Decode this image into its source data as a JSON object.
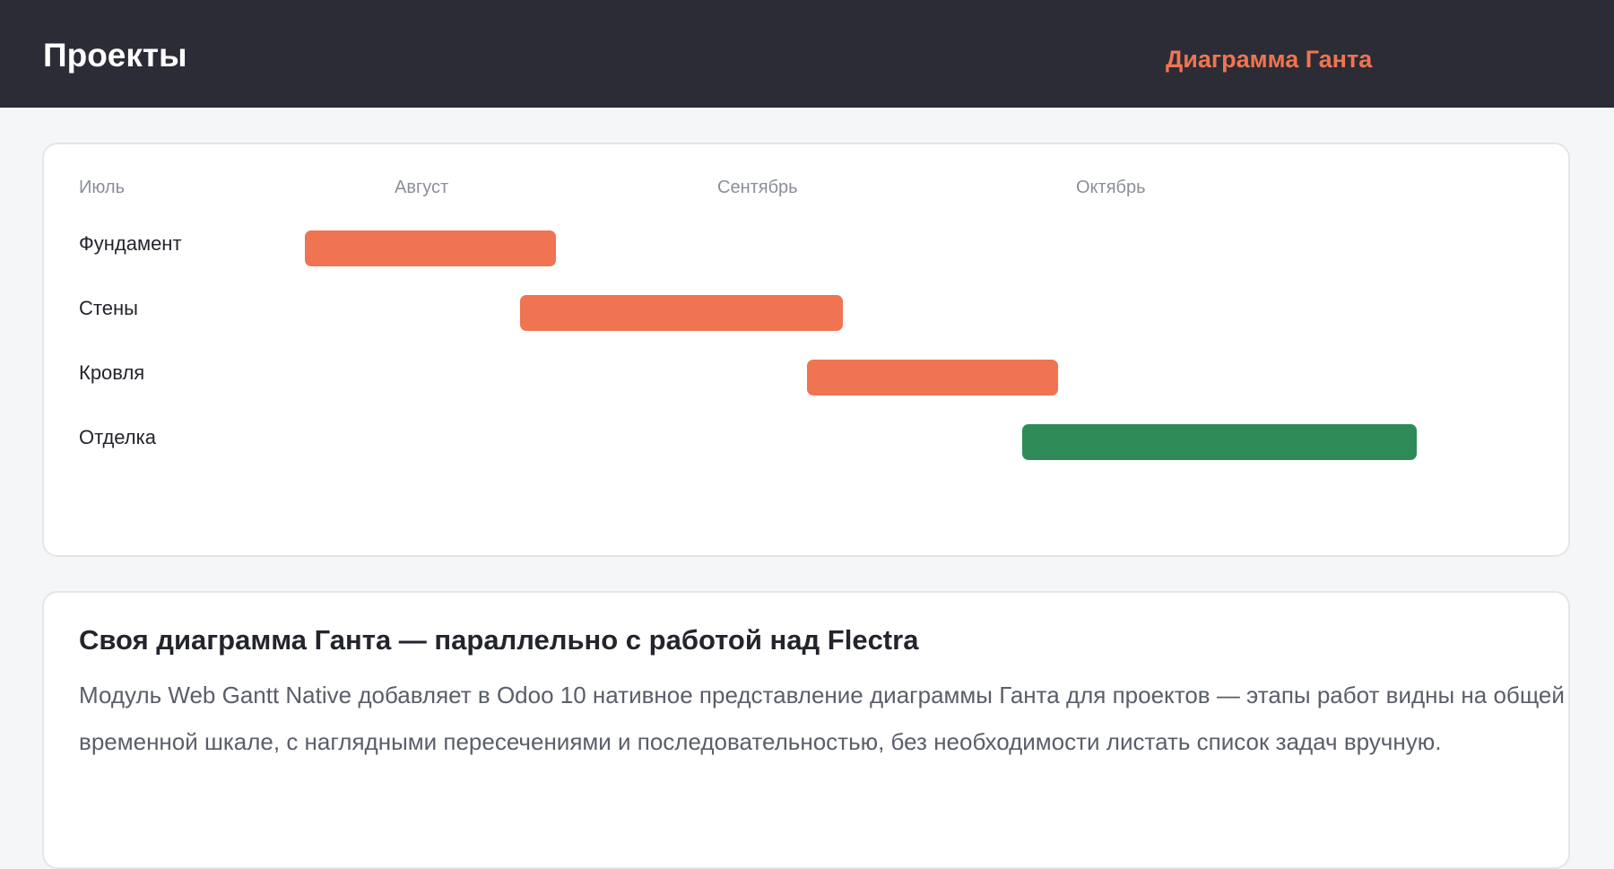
{
  "header": {
    "title": "Проекты",
    "view_link": "Диаграмма Ганта"
  },
  "gantt": {
    "months": [
      "Июль",
      "Август",
      "Сентябрь",
      "Октябрь"
    ],
    "tasks": [
      {
        "label": "Фундамент",
        "status": "in-progress",
        "color": "#f07452"
      },
      {
        "label": "Стены",
        "status": "in-progress",
        "color": "#f07452"
      },
      {
        "label": "Кровля",
        "status": "in-progress",
        "color": "#f07452"
      },
      {
        "label": "Отделка",
        "status": "done",
        "color": "#2e8b57"
      }
    ]
  },
  "info": {
    "title": "Своя диаграмма Ганта — параллельно с работой над Flectra",
    "text": "Модуль Web Gantt Native добавляет в Odoo 10 нативное представление диаграммы Ганта для проектов — этапы работ видны на общей временной шкале, с наглядными пересечениями и последовательностью, без необходимости листать список задач вручную."
  },
  "colors": {
    "topbar": "#2b2c35",
    "accent": "#f07452",
    "done": "#2e8b57",
    "background": "#f5f6f8"
  }
}
